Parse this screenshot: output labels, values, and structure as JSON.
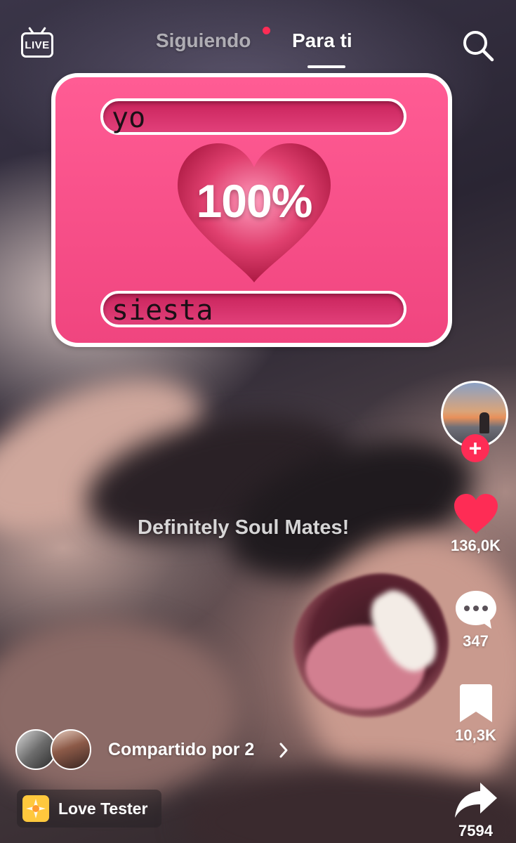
{
  "header": {
    "live_label": "LIVE",
    "tabs": [
      {
        "label": "Siguiendo",
        "active": false,
        "has_notification": true
      },
      {
        "label": "Para ti",
        "active": true
      }
    ]
  },
  "effect": {
    "name_top": "yo",
    "name_bottom": "siesta",
    "percent": "100%",
    "caption": "Definitely Soul Mates!"
  },
  "rail": {
    "likes": "136,0K",
    "comments": "347",
    "saves": "10,3K",
    "shares": "7594"
  },
  "footer": {
    "shared_by": "Compartido por 2",
    "effect_name": "Love Tester"
  },
  "colors": {
    "accent": "#fe2c55",
    "card_pink": "#f0457f",
    "effect_chip_icon": "#ffc83d"
  }
}
